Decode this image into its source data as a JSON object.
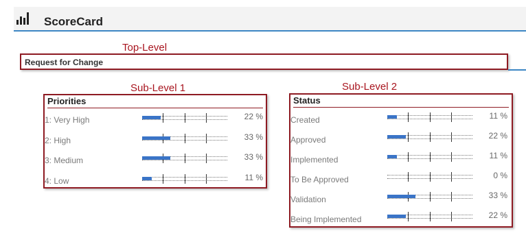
{
  "header": {
    "title": "ScoreCard",
    "icon": "bar-chart-icon"
  },
  "captions": {
    "top_level": "Top-Level",
    "sub_level_1": "Sub-Level 1",
    "sub_level_2": "Sub-Level 2"
  },
  "top_level": {
    "label": "Request for Change"
  },
  "colors": {
    "accent": "#3c86c4",
    "frame": "#8e1a22",
    "caption": "#a8141e",
    "bar_fill": "#3a74c7"
  },
  "priorities": {
    "heading": "Priorities",
    "rows": [
      {
        "label": "1: Very High",
        "percent_text": "22 %",
        "value": 0.22
      },
      {
        "label": "2: High",
        "percent_text": "33 %",
        "value": 0.33
      },
      {
        "label": "3: Medium",
        "percent_text": "33 %",
        "value": 0.33
      },
      {
        "label": "4: Low",
        "percent_text": "11 %",
        "value": 0.11
      }
    ]
  },
  "status": {
    "heading": "Status",
    "rows": [
      {
        "label": "Created",
        "percent_text": "11 %",
        "value": 0.11
      },
      {
        "label": "Approved",
        "percent_text": "22 %",
        "value": 0.22
      },
      {
        "label": "Implemented",
        "percent_text": "11 %",
        "value": 0.11
      },
      {
        "label": "To Be Approved",
        "percent_text": "0 %",
        "value": 0.0
      },
      {
        "label": "Validation",
        "percent_text": "33 %",
        "value": 0.33
      },
      {
        "label": "Being Implemented",
        "percent_text": "22 %",
        "value": 0.22
      }
    ]
  }
}
